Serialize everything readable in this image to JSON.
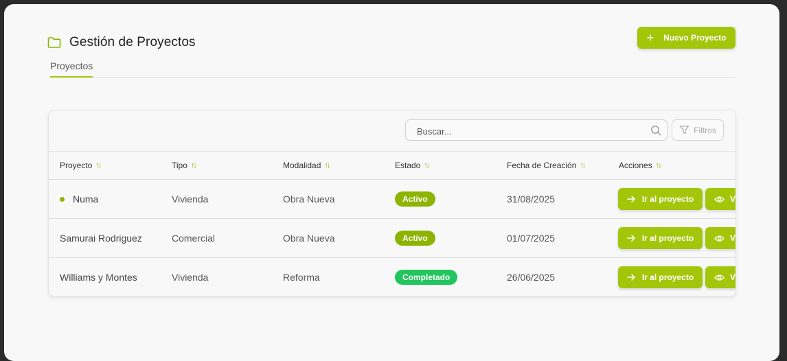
{
  "header": {
    "title": "Gestión de Proyectos",
    "new_button": "Nuevo Proyecto"
  },
  "tabs": [
    {
      "label": "Proyectos",
      "active": true
    }
  ],
  "toolbar": {
    "search_placeholder": "Buscar...",
    "filters_label": "Filtros"
  },
  "table": {
    "columns": [
      "Proyecto",
      "Tipo",
      "Modalidad",
      "Estado",
      "Fecha de Creación",
      "Acciones"
    ],
    "rows": [
      {
        "proyecto": "Numa",
        "tipo": "Vivienda",
        "modalidad": "Obra Nueva",
        "estado": "Activo",
        "fecha": "31/08/2025",
        "go_label": "Ir al proyecto",
        "view_label": "V",
        "indicator": true
      },
      {
        "proyecto": "Samurai Rodriguez",
        "tipo": "Comercial",
        "modalidad": "Obra Nueva",
        "estado": "Activo",
        "fecha": "01/07/2025",
        "go_label": "Ir al proyecto",
        "view_label": "V",
        "indicator": false
      },
      {
        "proyecto": "Williams y Montes",
        "tipo": "Vivienda",
        "modalidad": "Reforma",
        "estado": "Completado",
        "fecha": "26/06/2025",
        "go_label": "Ir al proyecto",
        "view_label": "V",
        "indicator": false
      }
    ]
  },
  "colors": {
    "accent": "#a4c60a",
    "active_badge": "#8db400",
    "completed_badge": "#22c55e"
  },
  "icons": [
    "folder-icon",
    "plus-icon",
    "search-icon",
    "filter-icon",
    "sort-icon",
    "arrow-right-icon",
    "eye-icon"
  ]
}
